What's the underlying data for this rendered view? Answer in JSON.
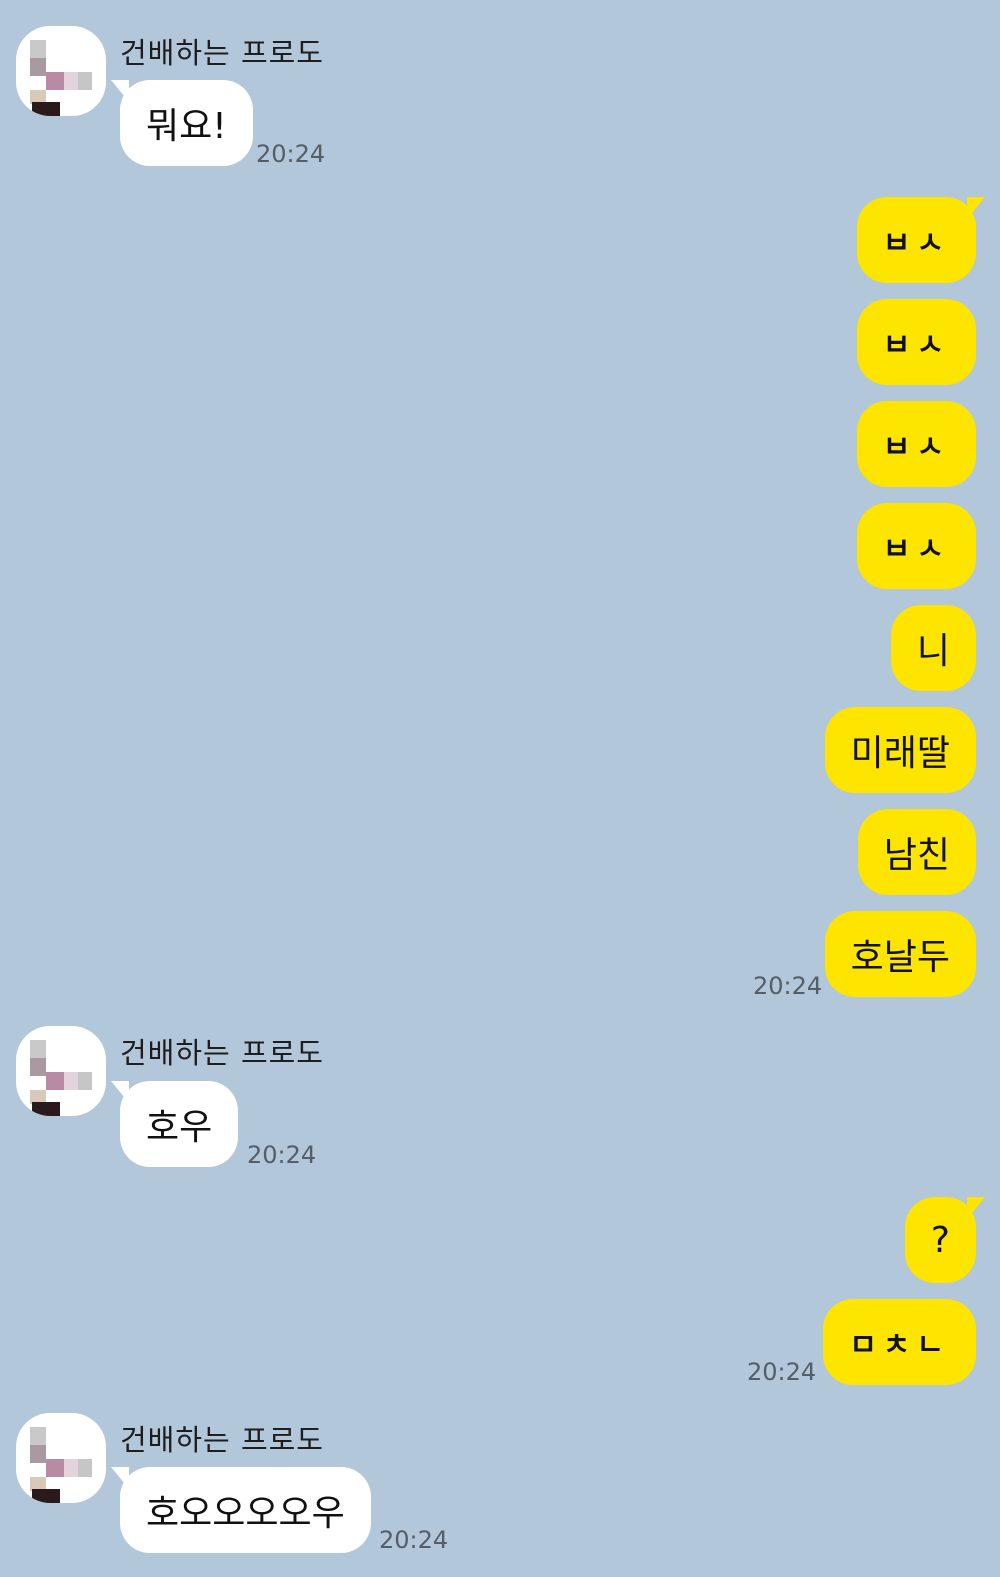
{
  "chat": {
    "sender_name": "건배하는 프로도",
    "timestamp": "20:24",
    "messages": [
      {
        "from": "other",
        "text": "뭐요!",
        "time": "20:24"
      },
      {
        "from": "me",
        "text": "ㅂㅅ"
      },
      {
        "from": "me",
        "text": "ㅂㅅ"
      },
      {
        "from": "me",
        "text": "ㅂㅅ"
      },
      {
        "from": "me",
        "text": "ㅂㅅ"
      },
      {
        "from": "me",
        "text": "니"
      },
      {
        "from": "me",
        "text": "미래딸"
      },
      {
        "from": "me",
        "text": "남친"
      },
      {
        "from": "me",
        "text": "호날두",
        "time": "20:24"
      },
      {
        "from": "other",
        "text": "호우",
        "time": "20:24"
      },
      {
        "from": "me",
        "text": "?"
      },
      {
        "from": "me",
        "text": "ㅁㅊㄴ",
        "time": "20:24"
      },
      {
        "from": "other",
        "text": "호오오오오우",
        "time": "20:24"
      }
    ]
  },
  "colors": {
    "background": "#b2c7da",
    "my_bubble": "#fee500",
    "other_bubble": "#ffffff"
  }
}
